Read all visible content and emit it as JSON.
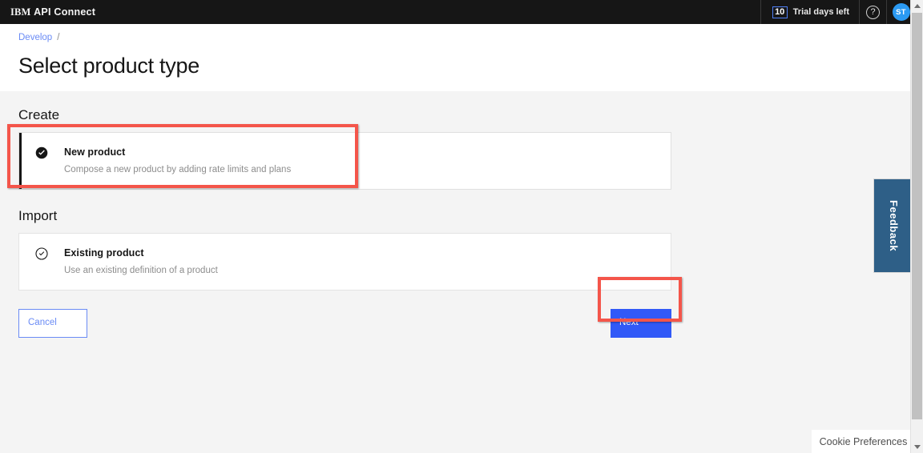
{
  "topbar": {
    "brand_prefix": "IBM",
    "brand_name": "API Connect",
    "trial_count": "10",
    "trial_label": "Trial days left",
    "help_glyph": "?",
    "avatar_initials": "ST"
  },
  "header": {
    "breadcrumb_item": "Develop",
    "breadcrumb_separator": "/",
    "page_title": "Select product type"
  },
  "main": {
    "create_section": {
      "heading": "Create",
      "tile": {
        "title": "New product",
        "description": "Compose a new product by adding rate limits and plans",
        "selected": true,
        "icon": "checkmark-filled-icon"
      }
    },
    "import_section": {
      "heading": "Import",
      "tile": {
        "title": "Existing product",
        "description": "Use an existing definition of a product",
        "selected": false,
        "icon": "checkmark-outline-icon"
      }
    },
    "actions": {
      "cancel_label": "Cancel",
      "next_label": "Next"
    }
  },
  "feedback": {
    "label": "Feedback"
  },
  "cookie": {
    "label": "Cookie Preferences"
  },
  "colors": {
    "accent_blue": "#3159f7",
    "link_blue": "#6a8bf5",
    "topbar_black": "#161616",
    "page_bg": "#f4f4f4",
    "annotation_red": "#f4554a",
    "avatar_blue": "#2b9af3",
    "feedback_blue": "#2e5f87"
  }
}
